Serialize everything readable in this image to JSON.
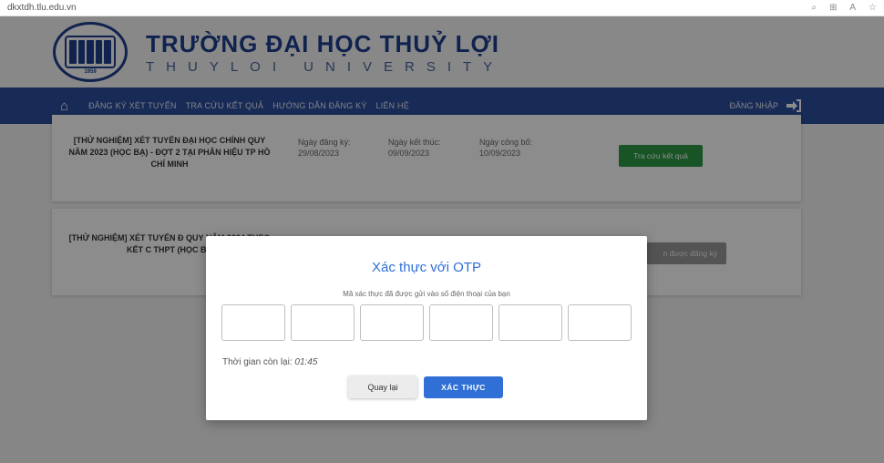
{
  "browser": {
    "url": "dkxtdh.tlu.edu.vn",
    "icons": [
      "search-icon",
      "badge-icon",
      "read-aloud-icon",
      "favorite-icon"
    ]
  },
  "header": {
    "title": "TRƯỜNG ĐẠI HỌC THUỶ LỢI",
    "subtitle": "THUYLOI UNIVERSITY",
    "logo_year": "1959"
  },
  "nav": {
    "items": [
      "ĐĂNG KÝ XÉT TUYỂN",
      "TRA CỨU KẾT QUẢ",
      "HƯỚNG DẪN ĐĂNG KÝ",
      "LIÊN HỆ"
    ],
    "login": "ĐĂNG NHẬP"
  },
  "cards": [
    {
      "title": "[THỬ NGHIỆM] XÉT TUYỂN ĐẠI HỌC CHÍNH QUY NĂM 2023 (HỌC BẠ) - ĐỢT 2 TẠI PHÂN HIỆU TP HỒ CHÍ MINH",
      "registration_label": "Ngày đăng ký:",
      "registration_date": "29/08/2023",
      "end_label": "Ngày kết thúc:",
      "end_date": "09/09/2023",
      "announce_label": "Ngày công bố:",
      "announce_date": "10/09/2023",
      "button": "Tra cứu kết quả"
    },
    {
      "title": "[THỬ NGHIỆM] XÉT TUYỂN Đ QUY NĂM 2024 THEO KẾT C THPT (HỌC BA",
      "button": "n được đăng ký"
    }
  ],
  "modal": {
    "title": "Xác thực với OTP",
    "description": "Mã xác thực đã được gửi vào số điện thoại của bạn",
    "otp_count": 6,
    "timer_label": "Thời gian còn lại:",
    "timer_value": "01:45",
    "back_button": "Quay lại",
    "verify_button": "XÁC THỰC"
  },
  "colors": {
    "brand": "#1e3f8f",
    "nav": "#2c4f9e",
    "accent": "#2f6fd6",
    "success": "#2e9a48"
  }
}
